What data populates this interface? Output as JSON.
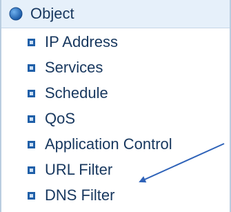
{
  "menu": {
    "header": {
      "label": "Object",
      "icon": "blue-circle-icon"
    },
    "items": [
      {
        "label": "IP Address",
        "icon": "square-bullet-icon"
      },
      {
        "label": "Services",
        "icon": "square-bullet-icon"
      },
      {
        "label": "Schedule",
        "icon": "square-bullet-icon"
      },
      {
        "label": "QoS",
        "icon": "square-bullet-icon"
      },
      {
        "label": "Application Control",
        "icon": "square-bullet-icon"
      },
      {
        "label": "URL Filter",
        "icon": "square-bullet-icon"
      },
      {
        "label": "DNS Filter",
        "icon": "square-bullet-icon"
      }
    ]
  },
  "colors": {
    "text": "#17375e",
    "header_bg": "#e6f0fa",
    "bullet": "#1f5fa8",
    "arrow": "#2e62b8"
  }
}
